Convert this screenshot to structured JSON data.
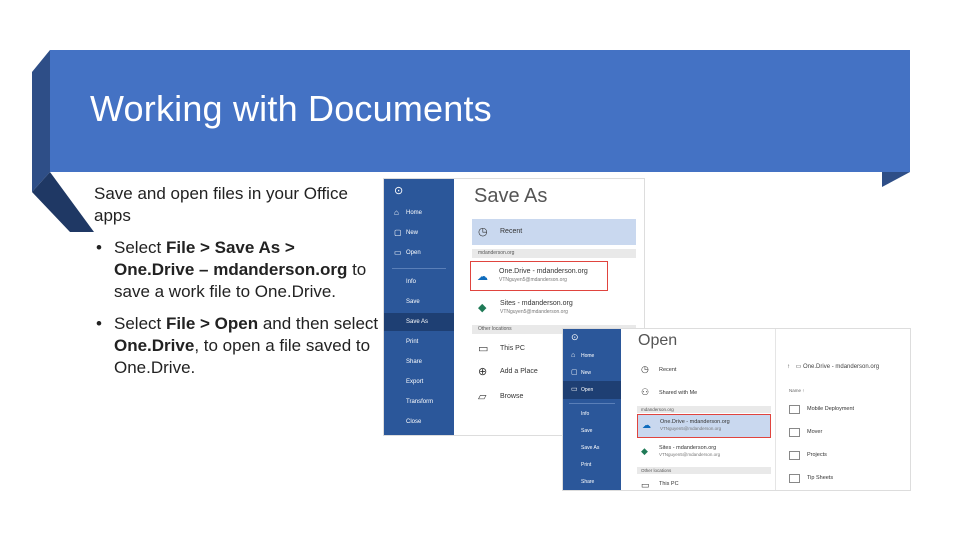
{
  "slide": {
    "title": "Working with Documents",
    "intro": "Save and open files in your Office apps",
    "bullets": [
      {
        "pre": "Select ",
        "b1": "File > Save As > One.Drive – mdanderson.org",
        "mid": " to save a work file to One.Drive.",
        "b2": "",
        "post": ""
      },
      {
        "pre": "Select ",
        "b1": "File > Open",
        "mid": " and then select ",
        "b2": "One.Drive",
        "post": ", to open a file saved to One.Drive."
      }
    ]
  },
  "colors": {
    "band": "#4472c4",
    "office_blue": "#2b579a",
    "highlight": "#e0443e"
  },
  "save_as": {
    "title": "Save As",
    "nav": [
      {
        "label": "Home",
        "icon": "home-icon"
      },
      {
        "label": "New",
        "icon": "new-doc-icon"
      },
      {
        "label": "Open",
        "icon": "folder-open-icon"
      },
      {
        "label": "Info"
      },
      {
        "label": "Save"
      },
      {
        "label": "Save As",
        "selected": true
      },
      {
        "label": "Print"
      },
      {
        "label": "Share"
      },
      {
        "label": "Export"
      },
      {
        "label": "Transform"
      },
      {
        "label": "Close"
      }
    ],
    "recent_label": "Recent",
    "section_org": "mdanderson.org",
    "onedrive_title": "One.Drive - mdanderson.org",
    "onedrive_email": "VTNguyen5@mdanderson.org",
    "sites_title": "Sites - mdanderson.org",
    "sites_email": "VTNguyen5@mdanderson.org",
    "section_other": "Other locations",
    "this_pc": "This PC",
    "add_place": "Add a Place",
    "browse": "Browse"
  },
  "open": {
    "title": "Open",
    "nav": [
      {
        "label": "Home",
        "icon": "home-icon"
      },
      {
        "label": "New",
        "icon": "new-doc-icon"
      },
      {
        "label": "Open",
        "icon": "folder-open-icon",
        "selected": true
      },
      {
        "label": "Info"
      },
      {
        "label": "Save"
      },
      {
        "label": "Save As"
      },
      {
        "label": "Print"
      },
      {
        "label": "Share"
      }
    ],
    "recent_label": "Recent",
    "shared_label": "Shared with Me",
    "section_org": "mdanderson.org",
    "onedrive_title": "One.Drive - mdanderson.org",
    "onedrive_email": "VTNguyen5@mdanderson.org",
    "sites_title": "Sites - mdanderson.org",
    "sites_email": "VTNguyen5@mdanderson.org",
    "section_other": "Other locations",
    "this_pc": "This PC",
    "breadcrumb": "One.Drive - mdanderson.org",
    "name_header": "Name ↑",
    "folders": [
      "Mobile Deployment",
      "Mover",
      "Projects",
      "Tip Sheets"
    ]
  }
}
